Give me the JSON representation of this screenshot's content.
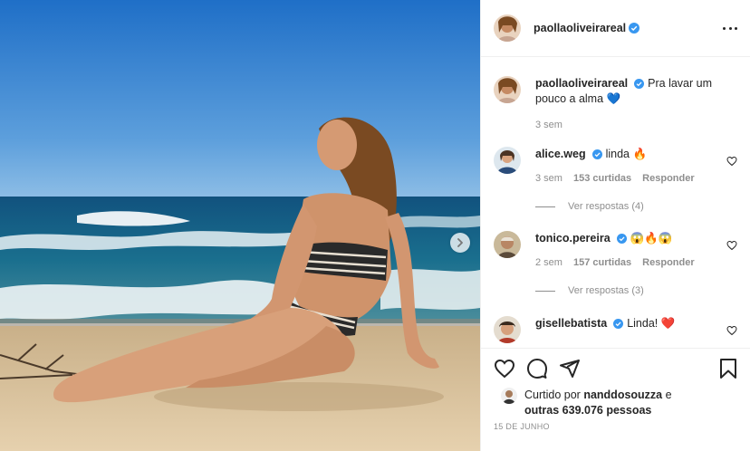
{
  "post": {
    "author": "paollaoliveirareal",
    "caption": "Pra lavar um pouco a alma 💙",
    "caption_age": "3 sem",
    "likes_prefix": "Curtido por",
    "likes_user": "nanddosouzza",
    "likes_connector": "e",
    "likes_rest": "outras 639.076 pessoas",
    "date": "15 DE JUNHO"
  },
  "comments": [
    {
      "user": "alice.weg",
      "text": "linda 🔥",
      "age": "3 sem",
      "likes": "153 curtidas",
      "reply": "Responder",
      "replies": "Ver respostas (4)"
    },
    {
      "user": "tonico.pereira",
      "text": "😱🔥😱",
      "age": "2 sem",
      "likes": "157 curtidas",
      "reply": "Responder",
      "replies": "Ver respostas (3)"
    },
    {
      "user": "gisellebatista",
      "text": "Linda! ❤️"
    }
  ],
  "icons": {
    "more": "more-options-icon",
    "next": "chevron-right-icon",
    "like": "heart-icon",
    "comment": "comment-icon",
    "share": "paper-plane-icon",
    "save": "bookmark-icon"
  },
  "colors": {
    "verified": "#3897f0",
    "muted": "#8e8e8e",
    "text": "#262626"
  }
}
